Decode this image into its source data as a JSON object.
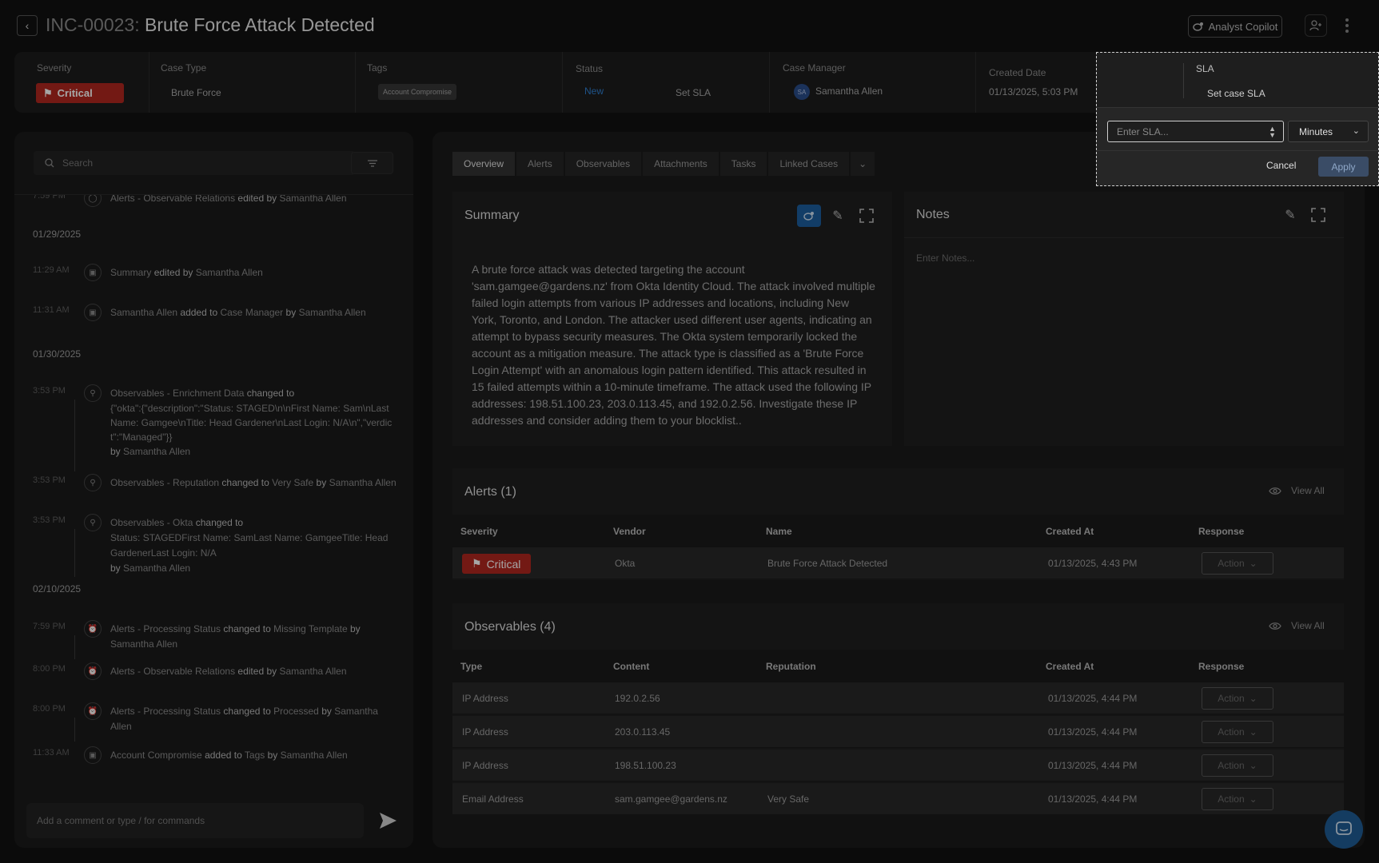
{
  "header": {
    "case_id": "INC-00023:",
    "case_name": "Brute Force Attack Detected",
    "copilot_label": "Analyst Copilot"
  },
  "info": {
    "severity_label": "Severity",
    "severity_value": "Critical",
    "case_type_label": "Case Type",
    "case_type_value": "Brute Force",
    "tags_label": "Tags",
    "tag_value": "Account Compromise",
    "status_label": "Status",
    "status_value": "New",
    "set_sla": "Set SLA",
    "case_manager_label": "Case Manager",
    "case_manager_initials": "SA",
    "case_manager_value": "Samantha Allen",
    "created_label": "Created Date",
    "created_value": "01/13/2025, 5:03 PM"
  },
  "left": {
    "search_placeholder": "Search",
    "dates": [
      "01/29/2025",
      "01/30/2025",
      "02/10/2025"
    ],
    "items": [
      {
        "time": "7:59 PM",
        "pre": "Alerts - Observable Relations",
        "verb": "edited by",
        "post": "Samantha Allen"
      },
      {
        "time": "11:29 AM",
        "pre": "Summary",
        "verb": "edited by",
        "post": "Samantha Allen"
      },
      {
        "time": "11:31 AM",
        "pre": "Samantha Allen",
        "verb": "added to",
        "post": "Case Manager",
        "verb2": "by",
        "post2": "Samantha Allen"
      },
      {
        "time": "3:53 PM",
        "pre": "Observables - Enrichment Data",
        "verb": "changed to",
        "detail": "{\"okta\":{\"description\":\"Status: STAGED\\n\\nFirst Name: Sam\\nLast Name: Gamgee\\nTitle: Head Gardener\\nLast Login: N/A\\n\",\"verdict\":\"Managed\"}}",
        "by": "by",
        "who": "Samantha Allen"
      },
      {
        "time": "3:53 PM",
        "pre": "Observables - Reputation",
        "verb": "changed to",
        "post": "Very Safe",
        "verb2": "by",
        "post2": "Samantha Allen"
      },
      {
        "time": "3:53 PM",
        "pre": "Observables - Okta",
        "verb": "changed to",
        "detail": "Status: STAGEDFirst Name: SamLast Name: GamgeeTitle: Head GardenerLast Login: N/A",
        "by": "by",
        "who": "Samantha Allen"
      },
      {
        "time": "7:59 PM",
        "pre": "Alerts - Processing Status",
        "verb": "changed to",
        "post": "Missing Template",
        "verb2": "by",
        "post2": "Samantha Allen"
      },
      {
        "time": "8:00 PM",
        "pre": "Alerts - Observable Relations",
        "verb": "edited by",
        "post": "Samantha Allen"
      },
      {
        "time": "8:00 PM",
        "pre": "Alerts - Processing Status",
        "verb": "changed to",
        "post": "Processed",
        "verb2": "by",
        "post2": "Samantha Allen"
      },
      {
        "time": "11:33 AM",
        "pre": "Account Compromise",
        "verb": "added to",
        "post": "Tags",
        "verb2": "by",
        "post2": "Samantha Allen"
      }
    ],
    "comment_placeholder": "Add a comment or type / for commands"
  },
  "tabs": [
    "Overview",
    "Alerts",
    "Observables",
    "Attachments",
    "Tasks",
    "Linked Cases"
  ],
  "summary": {
    "title": "Summary",
    "text": "A brute force attack was detected targeting the account 'sam.gamgee@gardens.nz' from Okta Identity Cloud. The attack involved multiple failed login attempts from various IP addresses and locations, including New York, Toronto, and London. The attacker used different user agents, indicating an attempt to bypass security measures.  The Okta system temporarily locked the account as a mitigation measure. The attack type is classified as a 'Brute Force Login Attempt' with an anomalous login pattern identified. This attack resulted in 15 failed attempts within a 10-minute timeframe.  The attack used the following IP addresses: 198.51.100.23, 203.0.113.45, and 192.0.2.56.  Investigate these IP addresses and consider adding them to your blocklist.."
  },
  "notes": {
    "title": "Notes",
    "placeholder": "Enter Notes..."
  },
  "alerts": {
    "title": "Alerts (1)",
    "view_all": "View All",
    "columns": [
      "Severity",
      "Vendor",
      "Name",
      "Created At",
      "Response"
    ],
    "rows": [
      {
        "severity": "Critical",
        "vendor": "Okta",
        "name": "Brute Force Attack Detected",
        "created": "01/13/2025, 4:43 PM",
        "action": "Action"
      }
    ]
  },
  "observables": {
    "title": "Observables (4)",
    "view_all": "View All",
    "columns": [
      "Type",
      "Content",
      "Reputation",
      "Created At",
      "Response"
    ],
    "rows": [
      {
        "type": "IP Address",
        "content": "192.0.2.56",
        "reputation": "",
        "created": "01/13/2025, 4:44 PM",
        "action": "Action"
      },
      {
        "type": "IP Address",
        "content": "203.0.113.45",
        "reputation": "",
        "created": "01/13/2025, 4:44 PM",
        "action": "Action"
      },
      {
        "type": "IP Address",
        "content": "198.51.100.23",
        "reputation": "",
        "created": "01/13/2025, 4:44 PM",
        "action": "Action"
      },
      {
        "type": "Email Address",
        "content": "sam.gamgee@gardens.nz",
        "reputation": "Very Safe",
        "created": "01/13/2025, 4:44 PM",
        "action": "Action"
      }
    ]
  },
  "sla_popup": {
    "label": "SLA",
    "set_case_sla": "Set case SLA",
    "input_placeholder": "Enter SLA...",
    "unit": "Minutes",
    "cancel": "Cancel",
    "apply": "Apply"
  },
  "colors": {
    "critical": "#b1271f",
    "accent_blue": "#2f7fd0",
    "panel_bg": "#1b1b1b"
  }
}
